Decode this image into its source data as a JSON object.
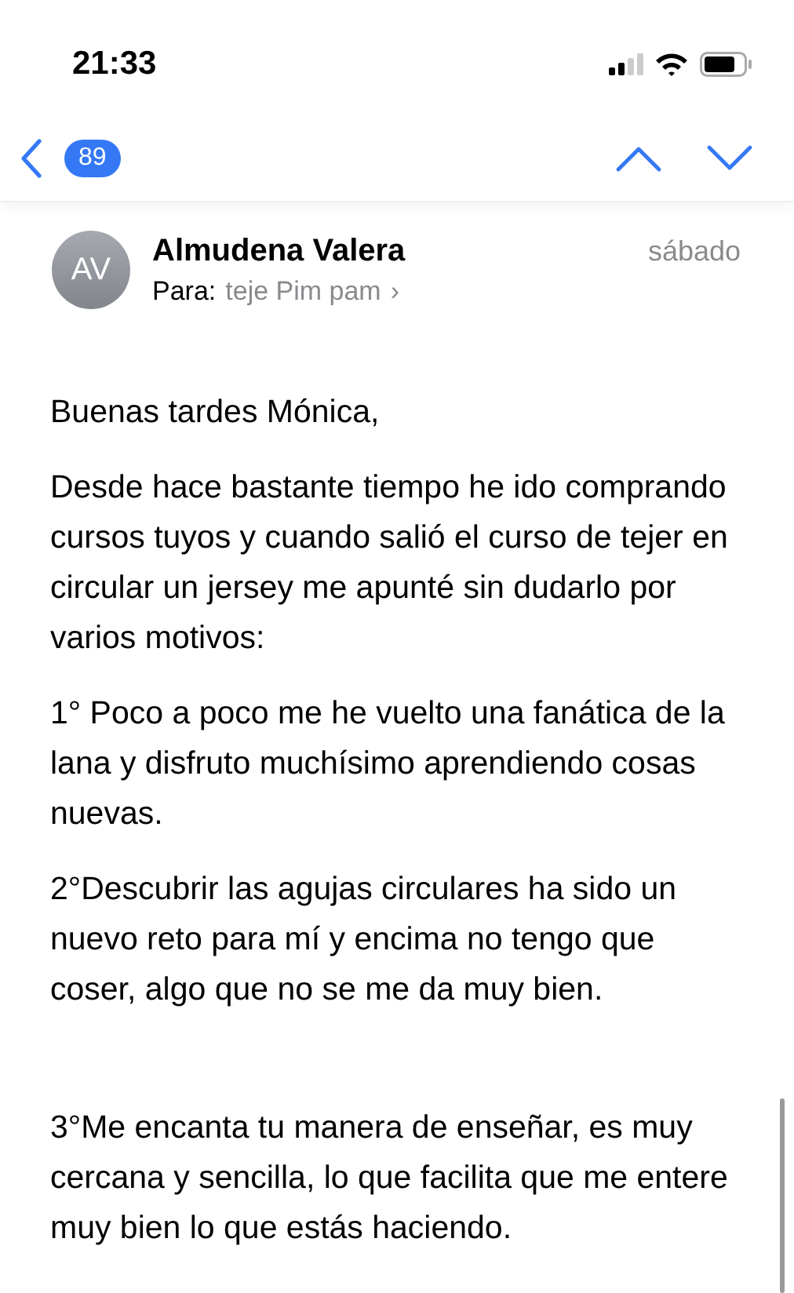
{
  "status_bar": {
    "time": "21:33"
  },
  "nav": {
    "unread_count": "89"
  },
  "message": {
    "avatar_initials": "AV",
    "sender": "Almudena Valera",
    "date": "sábado",
    "to_label": "Para:",
    "recipient": "teje Pim pam",
    "recipient_chevron": "›",
    "paragraphs": [
      {
        "text": "Buenas tardes Mónica,",
        "blank_line_before": false
      },
      {
        "text": "Desde hace bastante tiempo he ido comprando cursos tuyos y cuando salió el curso de tejer en circular un jersey me apunté sin dudarlo por varios motivos:",
        "blank_line_before": false
      },
      {
        "text": "1° Poco a poco me he vuelto una fanática de la lana y disfruto muchísimo aprendiendo cosas nuevas.",
        "blank_line_before": false
      },
      {
        "text": "2°Descubrir las agujas circulares ha sido un nuevo reto para mí y encima no tengo que coser, algo que no se me da muy bien.",
        "blank_line_before": false
      },
      {
        "text": "3°Me encanta tu manera de enseñar, es muy cercana y sencilla, lo que facilita que me entere muy bien lo que estás haciendo.",
        "blank_line_before": true
      }
    ]
  }
}
